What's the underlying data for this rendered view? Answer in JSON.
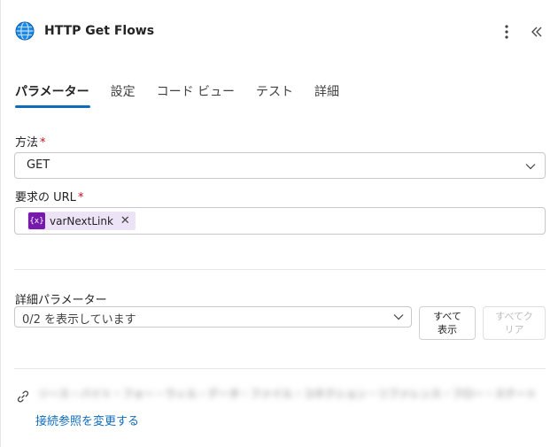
{
  "header": {
    "title": "HTTP Get Flows",
    "app_icon": "globe-icon",
    "more_icon": "more-vertical-icon",
    "collapse_icon": "double-chevron-left-icon"
  },
  "tabs": [
    {
      "label": "パラメーター",
      "active": true
    },
    {
      "label": "設定",
      "active": false
    },
    {
      "label": "コード ビュー",
      "active": false
    },
    {
      "label": "テスト",
      "active": false
    },
    {
      "label": "詳細",
      "active": false
    }
  ],
  "method": {
    "label": "方法",
    "required_mark": "*",
    "value": "GET"
  },
  "url": {
    "label": "要求の URL",
    "required_mark": "*",
    "token": {
      "icon_text": "{x}",
      "text": "varNextLink"
    }
  },
  "advanced": {
    "label": "詳細パラメーター",
    "select_value": "0/2 を表示しています",
    "show_all_label": "すべて\n表示",
    "clear_all_label": "すべてク\nリア"
  },
  "connection": {
    "text": "ソース・バイト・フォー・ウィル・データ・ファイル・コネクション・リファレンス・フロー・ステート",
    "change_link": "接続参照を変更する"
  },
  "colors": {
    "accent": "#0f6cbd",
    "required": "#c50f1f",
    "token_bg": "#ede3f7",
    "token_icon": "#7719aa"
  }
}
